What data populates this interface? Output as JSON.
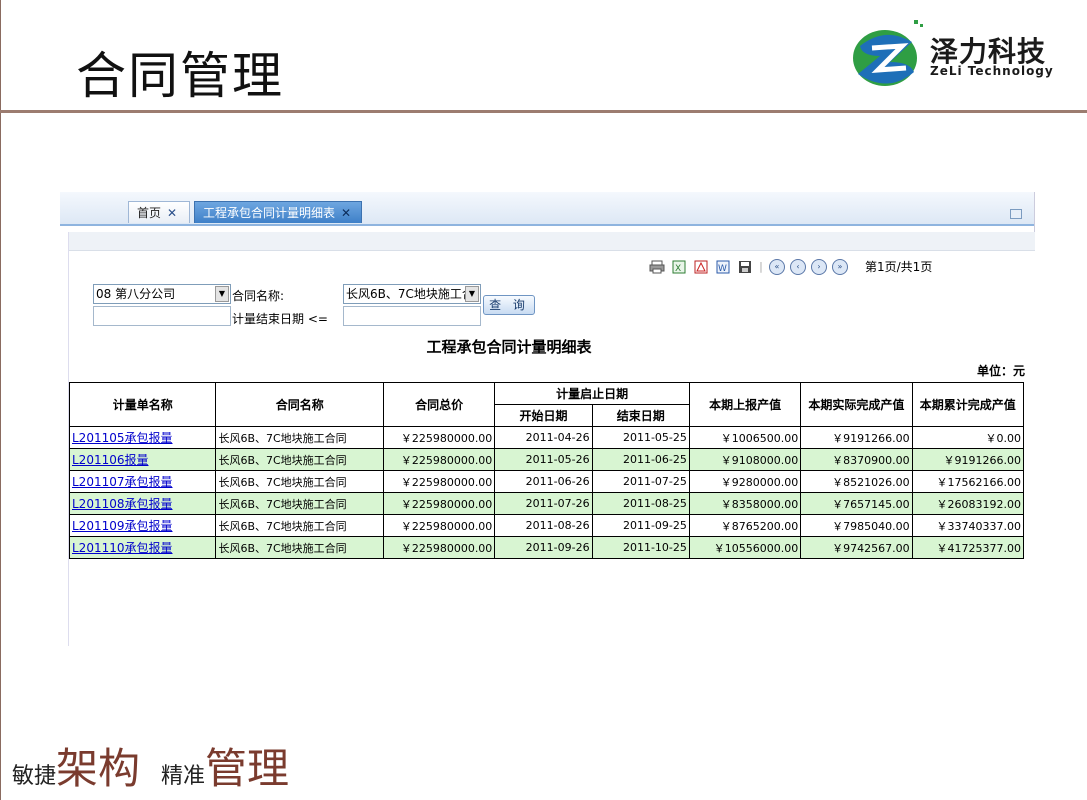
{
  "slide": {
    "title": "合同管理",
    "logo_cn": "泽力科技",
    "logo_en": "ZeLi Technology",
    "slogan": [
      {
        "small": "敏捷",
        "big": "架构"
      },
      {
        "small": "精准",
        "big": "管理"
      }
    ]
  },
  "tabs": [
    {
      "label": "首页"
    },
    {
      "label": "工程承包合同计量明细表"
    }
  ],
  "toolbar": {
    "page_info": "第1页/共1页"
  },
  "filters": {
    "company_value": "08 第八分公司",
    "contract_label": "合同名称:",
    "contract_value": "长风6B、7C地块施工合",
    "end_date_label": "计量结束日期 <=",
    "query_button": "查 询"
  },
  "report": {
    "title": "工程承包合同计量明细表",
    "unit": "单位：元",
    "headers": {
      "name": "计量单名称",
      "contract": "合同名称",
      "total": "合同总价",
      "period": "计量启止日期",
      "start": "开始日期",
      "end": "结束日期",
      "reported": "本期上报产值",
      "actual": "本期实际完成产值",
      "cumulative": "本期累计完成产值"
    },
    "rows": [
      {
        "name": "L201105承包报量",
        "contract": "长风6B、7C地块施工合同",
        "total": "￥225980000.00",
        "start": "2011-04-26",
        "end": "2011-05-25",
        "reported": "￥1006500.00",
        "actual": "￥9191266.00",
        "cumulative": "￥0.00"
      },
      {
        "name": "L201106报量",
        "contract": "长风6B、7C地块施工合同",
        "total": "￥225980000.00",
        "start": "2011-05-26",
        "end": "2011-06-25",
        "reported": "￥9108000.00",
        "actual": "￥8370900.00",
        "cumulative": "￥9191266.00"
      },
      {
        "name": "L201107承包报量",
        "contract": "长风6B、7C地块施工合同",
        "total": "￥225980000.00",
        "start": "2011-06-26",
        "end": "2011-07-25",
        "reported": "￥9280000.00",
        "actual": "￥8521026.00",
        "cumulative": "￥17562166.00"
      },
      {
        "name": "L201108承包报量",
        "contract": "长风6B、7C地块施工合同",
        "total": "￥225980000.00",
        "start": "2011-07-26",
        "end": "2011-08-25",
        "reported": "￥8358000.00",
        "actual": "￥7657145.00",
        "cumulative": "￥26083192.00"
      },
      {
        "name": "L201109承包报量",
        "contract": "长风6B、7C地块施工合同",
        "total": "￥225980000.00",
        "start": "2011-08-26",
        "end": "2011-09-25",
        "reported": "￥8765200.00",
        "actual": "￥7985040.00",
        "cumulative": "￥33740337.00"
      },
      {
        "name": "L201110承包报量",
        "contract": "长风6B、7C地块施工合同",
        "total": "￥225980000.00",
        "start": "2011-09-26",
        "end": "2011-10-25",
        "reported": "￥10556000.00",
        "actual": "￥9742567.00",
        "cumulative": "￥41725377.00"
      }
    ]
  },
  "colors": {
    "alt_row": "#d8f5d2",
    "tab_active": "#3e80c8",
    "brand_line": "#9c7c70"
  }
}
